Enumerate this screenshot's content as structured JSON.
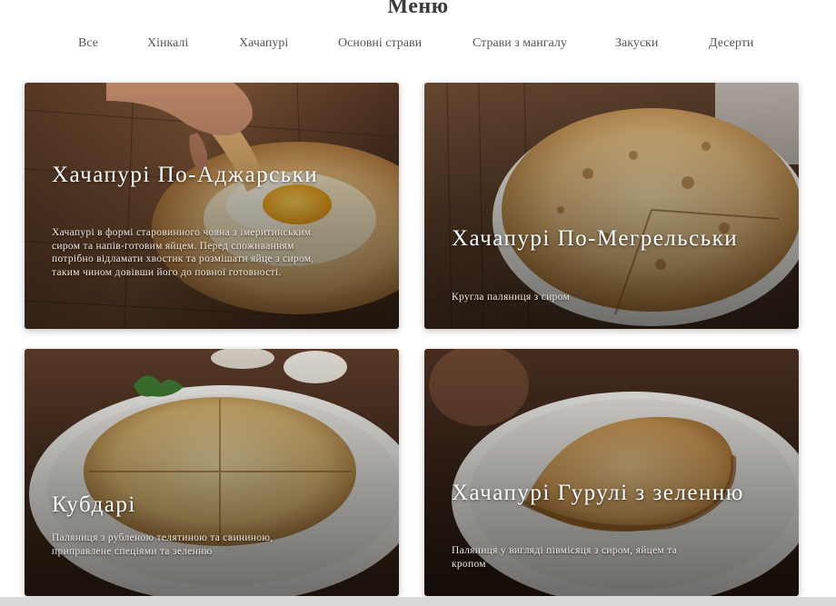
{
  "menu": {
    "title": "Меню"
  },
  "tabs": [
    {
      "label": "Все"
    },
    {
      "label": "Хінкалі"
    },
    {
      "label": "Хачапурі"
    },
    {
      "label": "Основні страви"
    },
    {
      "label": "Страви з мангалу"
    },
    {
      "label": "Закуски"
    },
    {
      "label": "Десерти"
    }
  ],
  "cards": [
    {
      "title": "Хачапурі По-Аджарськи",
      "description": "Хачапурі в формі старовинного човна з імеритинським сиром та напів-готовим яйцем. Перед споживанням потрібно відламати хвостик та розмішати яйце з сиром, таким чином довівши його до повної готовності."
    },
    {
      "title": "Хачапурі По-Мегрельськи",
      "description": "Кругла паляниця з сиром"
    },
    {
      "title": "Кубдарі",
      "description": "Паляниця з рубленою телятиною та свининою, приправлене спеціями та зеленню"
    },
    {
      "title": "Хачапурі Гурулі з зеленню",
      "description": "Паляниця у вигляді півмісяця з сиром, яйцем та кропом"
    }
  ]
}
